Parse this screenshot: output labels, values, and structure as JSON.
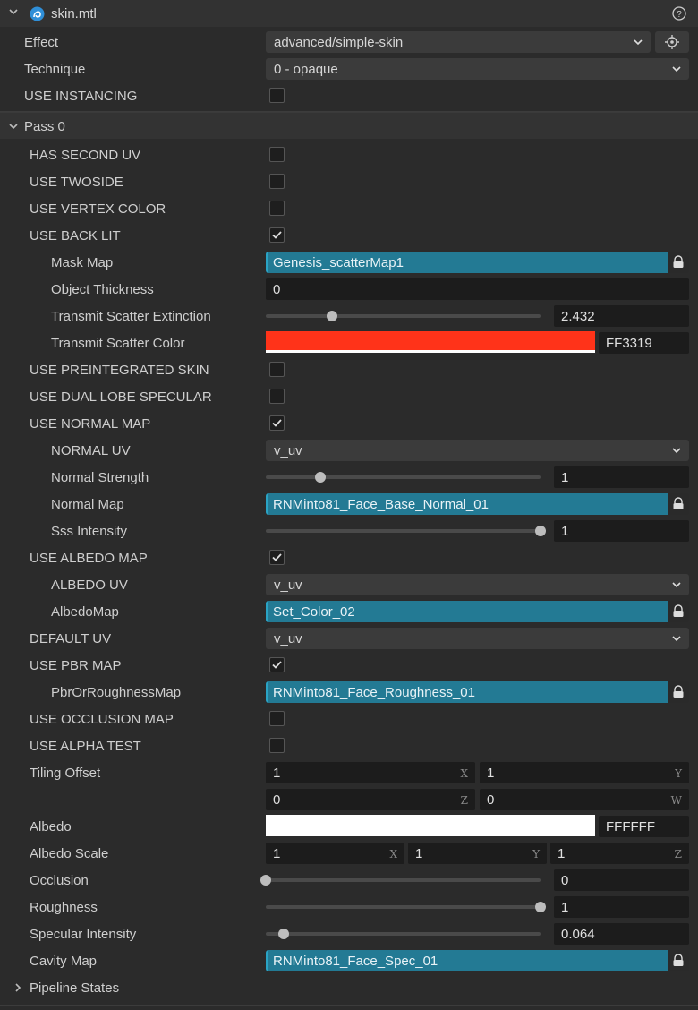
{
  "header": {
    "title": "skin.mtl"
  },
  "effect": {
    "label": "Effect",
    "value": "advanced/simple-skin"
  },
  "technique": {
    "label": "Technique",
    "value": "0 - opaque"
  },
  "use_instancing": {
    "label": "USE INSTANCING",
    "checked": false
  },
  "pass": {
    "label": "Pass 0"
  },
  "props": {
    "has_second_uv": {
      "label": "HAS SECOND UV",
      "checked": false
    },
    "use_twoside": {
      "label": "USE TWOSIDE",
      "checked": false
    },
    "use_vertex_color": {
      "label": "USE VERTEX COLOR",
      "checked": false
    },
    "use_back_lit": {
      "label": "USE BACK LIT",
      "checked": true
    },
    "mask_map": {
      "label": "Mask Map",
      "value": "Genesis_scatterMap1"
    },
    "object_thickness": {
      "label": "Object Thickness",
      "value": "0"
    },
    "transmit_scatter_extinction": {
      "label": "Transmit Scatter Extinction",
      "value": "2.432",
      "fraction": 0.24
    },
    "transmit_scatter_color": {
      "label": "Transmit Scatter Color",
      "value": "FF3319",
      "color": "#FF3319"
    },
    "use_preintegrated_skin": {
      "label": "USE PREINTEGRATED SKIN",
      "checked": false
    },
    "use_dual_lobe_specular": {
      "label": "USE DUAL LOBE SPECULAR",
      "checked": false
    },
    "use_normal_map": {
      "label": "USE NORMAL MAP",
      "checked": true
    },
    "normal_uv": {
      "label": "NORMAL UV",
      "value": "v_uv"
    },
    "normal_strength": {
      "label": "Normal Strength",
      "value": "1",
      "fraction": 0.2
    },
    "normal_map": {
      "label": "Normal Map",
      "value": "RNMinto81_Face_Base_Normal_01"
    },
    "sss_intensity": {
      "label": "Sss Intensity",
      "value": "1",
      "fraction": 1.0
    },
    "use_albedo_map": {
      "label": "USE ALBEDO MAP",
      "checked": true
    },
    "albedo_uv": {
      "label": "ALBEDO UV",
      "value": "v_uv"
    },
    "albedo_map": {
      "label": "AlbedoMap",
      "value": "Set_Color_02"
    },
    "default_uv": {
      "label": "DEFAULT UV",
      "value": "v_uv"
    },
    "use_pbr_map": {
      "label": "USE PBR MAP",
      "checked": true
    },
    "pbr_map": {
      "label": "PbrOrRoughnessMap",
      "value": "RNMinto81_Face_Roughness_01"
    },
    "use_occlusion_map": {
      "label": "USE OCCLUSION MAP",
      "checked": false
    },
    "use_alpha_test": {
      "label": "USE ALPHA TEST",
      "checked": false
    },
    "tiling_offset": {
      "label": "Tiling Offset",
      "x": "1",
      "y": "1",
      "z": "0",
      "w": "0"
    },
    "albedo": {
      "label": "Albedo",
      "value": "FFFFFF",
      "color": "#FFFFFF"
    },
    "albedo_scale": {
      "label": "Albedo Scale",
      "x": "1",
      "y": "1",
      "z": "1"
    },
    "occlusion": {
      "label": "Occlusion",
      "value": "0",
      "fraction": 0.0
    },
    "roughness": {
      "label": "Roughness",
      "value": "1",
      "fraction": 1.0
    },
    "specular_intensity": {
      "label": "Specular Intensity",
      "value": "0.064",
      "fraction": 0.064
    },
    "cavity_map": {
      "label": "Cavity Map",
      "value": "RNMinto81_Face_Spec_01"
    },
    "pipeline_states": {
      "label": "Pipeline States"
    }
  },
  "axes": {
    "x": "X",
    "y": "Y",
    "z": "Z",
    "w": "W"
  },
  "icons": {
    "collapse": "chevron-down-icon",
    "expand": "chevron-right-icon",
    "asset_lock": "lock-icon",
    "locate": "locate-icon",
    "help": "help-icon",
    "logo": "material-logo-icon"
  },
  "colors": {
    "accent": "#237a94",
    "background": "#2b2b2b",
    "field": "#1c1c1c"
  }
}
